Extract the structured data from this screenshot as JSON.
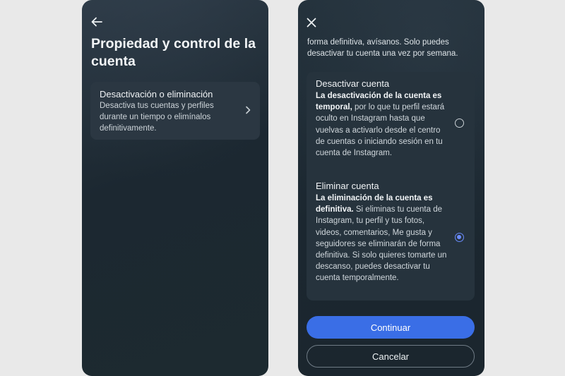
{
  "left_screen": {
    "title": "Propiedad y control de la cuenta",
    "option": {
      "title": "Desactivación o eliminación",
      "description": "Desactiva tus cuentas y perfiles durante un tiempo o elimínalos definitivamente."
    }
  },
  "right_screen": {
    "intro": "forma definitiva, avísanos. Solo puedes desactivar tu cuenta una vez por semana.",
    "deactivate": {
      "title": "Desactivar cuenta",
      "bold": "La desactivación de la cuenta es temporal,",
      "text": " por lo que tu perfil estará oculto en Instagram hasta que vuelvas a activarlo desde el centro de cuentas o iniciando sesión en tu cuenta de Instagram.",
      "selected": false
    },
    "delete": {
      "title": "Eliminar cuenta",
      "bold": "La eliminación de la cuenta es definitiva.",
      "text": " Si eliminas tu cuenta de Instagram, tu perfil y tus fotos, videos, comentarios, Me gusta y seguidores se eliminarán de forma definitiva. Si solo quieres tomarte un descanso, puedes desactivar tu cuenta temporalmente.",
      "selected": true
    },
    "continue_label": "Continuar",
    "cancel_label": "Cancelar"
  },
  "colors": {
    "accent": "#3a6ee6",
    "radio_selected": "#6a8cff",
    "background": "#1c2831"
  },
  "icons": {
    "back": "arrow-left-icon",
    "chevron": "chevron-right-icon",
    "close": "close-icon"
  }
}
